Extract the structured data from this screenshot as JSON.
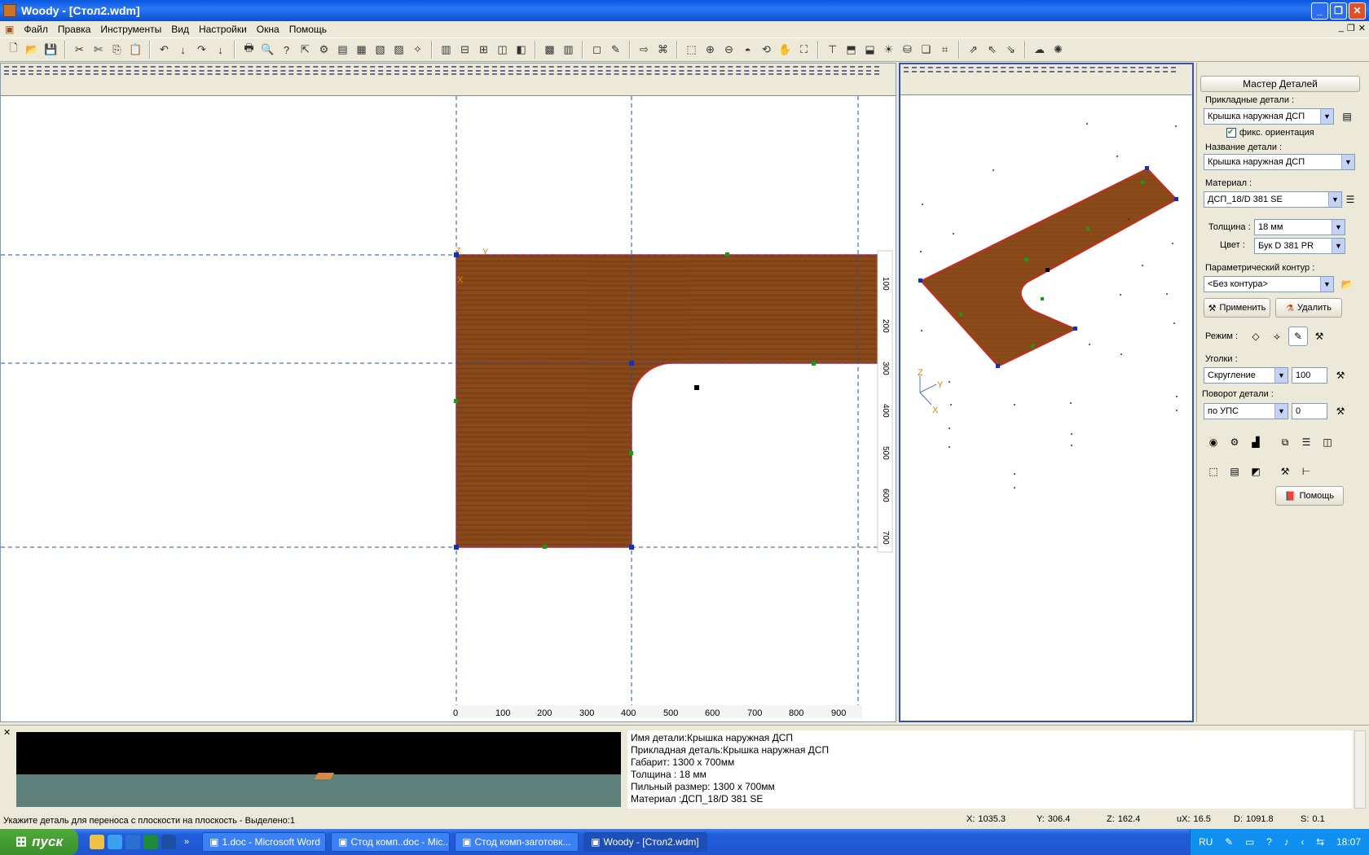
{
  "window": {
    "title": "Woody - [Стол2.wdm]"
  },
  "menu": [
    "Файл",
    "Правка",
    "Инструменты",
    "Вид",
    "Настройки",
    "Окна",
    "Помощь"
  ],
  "ruler_x": [
    "0",
    "100",
    "200",
    "300",
    "400",
    "500",
    "600",
    "700",
    "800",
    "900"
  ],
  "ruler_y": [
    "100",
    "200",
    "300",
    "400",
    "500",
    "600",
    "700"
  ],
  "panel": {
    "title": "Мастер Деталей",
    "applied_label": "Прикладные детали :",
    "applied_value": "Крышка наружная ДСП",
    "fix_orientation": "фикс. ориентация",
    "name_label": "Название детали :",
    "name_value": "Крышка наружная ДСП",
    "material_label": "Материал :",
    "material_value": "ДСП_18/D 381 SE",
    "thickness_label": "Толщина :",
    "thickness_value": "18 мм",
    "color_label": "Цвет :",
    "color_value": "Бук D 381 PR",
    "contour_label": "Параметрический контур :",
    "contour_value": "<Без контура>",
    "apply_button": "Применить",
    "delete_button": "Удалить",
    "mode_label": "Режим :",
    "corners_label": "Уголки :",
    "corners_value": "Скругление",
    "corners_radius": "100",
    "rotation_label": "Поворот детали :",
    "rotation_value": "по УПС",
    "rotation_angle": "0",
    "help_button": "Помощь"
  },
  "info": [
    "Имя детали:Крышка наружная ДСП",
    "Прикладная деталь:Крышка наружная ДСП",
    "Габарит: 1300 x 700мм",
    "Толщина : 18 мм",
    "Пильный размер: 1300 x 700мм",
    "Материал :ДСП_18/D 381 SE"
  ],
  "status": {
    "message": "Укажите деталь для переноса с плоскости на плоскость - Выделено:1",
    "x_label": "X:",
    "x": "1035.3",
    "y_label": "Y:",
    "y": "306.4",
    "z_label": "Z:",
    "z": "162.4",
    "ux_label": "uX:",
    "ux": "16.5",
    "d_label": "D:",
    "d": "1091.8",
    "s_label": "S:",
    "s": "0.1"
  },
  "taskbar": {
    "start": "пуск",
    "tasks": [
      "1.doc - Microsoft Word",
      "Стод комп..doc - Mic...",
      "Стод комп-заготовк...",
      "Woody - [Стол2.wdm]"
    ],
    "lang": "RU",
    "clock": "18:07"
  },
  "axis": {
    "x": "X",
    "y": "Y",
    "z": "Z"
  },
  "colors": {
    "wood": "#8a4a1a",
    "accent": "#2a78f5",
    "outline": "#e02020"
  }
}
